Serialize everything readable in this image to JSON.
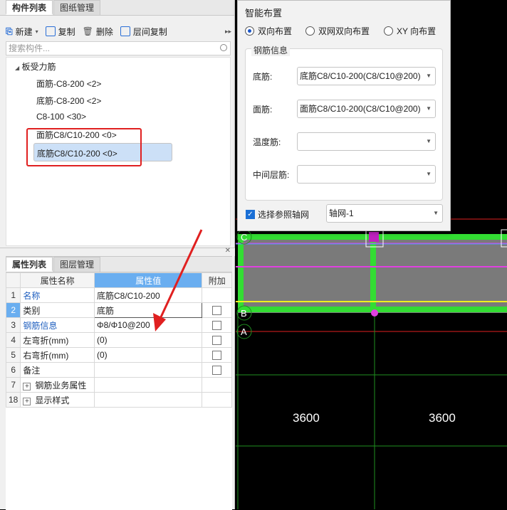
{
  "left_top": {
    "tabs": [
      "构件列表",
      "图纸管理"
    ],
    "toolbar": {
      "new": "新建",
      "copy": "复制",
      "delete": "删除",
      "floor_copy": "层间复制"
    },
    "search_placeholder": "搜索构件...",
    "tree": {
      "root": "板受力筋",
      "items": [
        "面筋-C8-200 <2>",
        "底筋-C8-200 <2>",
        "C8-100 <30>",
        "面筋C8/C10-200 <0>",
        "底筋C8/C10-200 <0>"
      ]
    }
  },
  "left_bottom": {
    "tabs": [
      "属性列表",
      "图层管理"
    ],
    "headers": {
      "name": "属性名称",
      "value": "属性值",
      "extra": "附加"
    },
    "rows": [
      {
        "num": "1",
        "name": "名称",
        "value": "底筋C8/C10-200"
      },
      {
        "num": "2",
        "name": "类别",
        "value": "底筋"
      },
      {
        "num": "3",
        "name": "钢筋信息",
        "value": "Φ8/Φ10@200"
      },
      {
        "num": "4",
        "name": "左弯折(mm)",
        "value": "(0)"
      },
      {
        "num": "5",
        "name": "右弯折(mm)",
        "value": "(0)"
      },
      {
        "num": "6",
        "name": "备注",
        "value": ""
      },
      {
        "num": "7",
        "name": "钢筋业务属性",
        "value": ""
      },
      {
        "num": "18",
        "name": "显示样式",
        "value": ""
      }
    ]
  },
  "dialog": {
    "title": "智能布置",
    "radios": [
      "双向布置",
      "双网双向布置",
      "XY 向布置"
    ],
    "group_label": "钢筋信息",
    "fields": [
      {
        "label": "底筋:",
        "value": "底筋C8/C10-200(C8/C10@200)"
      },
      {
        "label": "面筋:",
        "value": "面筋C8/C10-200(C8/C10@200)"
      },
      {
        "label": "温度筋:",
        "value": ""
      },
      {
        "label": "中间层筋:",
        "value": ""
      }
    ],
    "checkbox_label": "选择参照轴网",
    "axis_select": "轴网-1"
  },
  "canvas": {
    "dims": [
      "3600",
      "3600"
    ],
    "axis_labels": [
      "C",
      "B",
      "A"
    ]
  },
  "colors": {
    "accent": "#6aaef0",
    "highlight_red": "#e02020",
    "beam_green": "#33dd33"
  }
}
